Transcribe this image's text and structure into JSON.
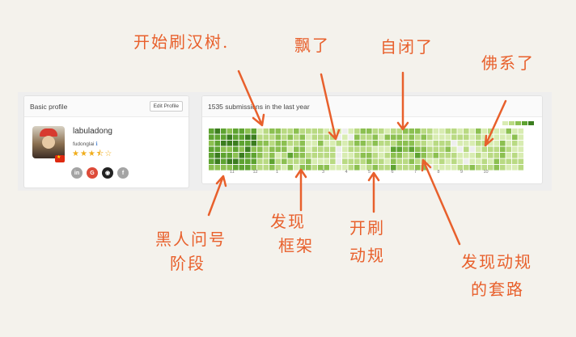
{
  "profile_card": {
    "header": "Basic profile",
    "edit_button": "Edit Profile",
    "username": "labuladong",
    "real_name": "fudonglai",
    "info_icon": "ℹ",
    "stars": "★★★⯪☆",
    "socials": [
      {
        "icon": "linkedin-icon",
        "label": "in",
        "color": "#a4a4a4"
      },
      {
        "icon": "google-icon",
        "label": "G",
        "color": "#dd4b39"
      },
      {
        "icon": "github-icon",
        "label": "◉",
        "color": "#222222"
      },
      {
        "icon": "facebook-icon",
        "label": "f",
        "color": "#a4a4a4"
      }
    ]
  },
  "submissions_card": {
    "header": "1535 submissions in the last year",
    "months": [
      "11",
      "12",
      "1",
      "2",
      "3",
      "4",
      "5",
      "6",
      "7",
      "8",
      "9",
      "10"
    ],
    "palette": [
      "#eeeeee",
      "#d8ecb2",
      "#b9da83",
      "#8cc051",
      "#5ea331",
      "#3b7d1f"
    ]
  },
  "annotations": {
    "start": "开始刷汉树.",
    "drift": "飘了",
    "closed": "自闭了",
    "zen": "佛系了",
    "beginner": [
      "黑人问号",
      "阶段"
    ],
    "framework": [
      "发现",
      "框架"
    ],
    "dp": [
      "开刷",
      "动规"
    ],
    "routine": [
      "发现动规",
      "的套路"
    ]
  },
  "colors": {
    "annotation": "#e8602c",
    "accent": "#5ea331"
  }
}
